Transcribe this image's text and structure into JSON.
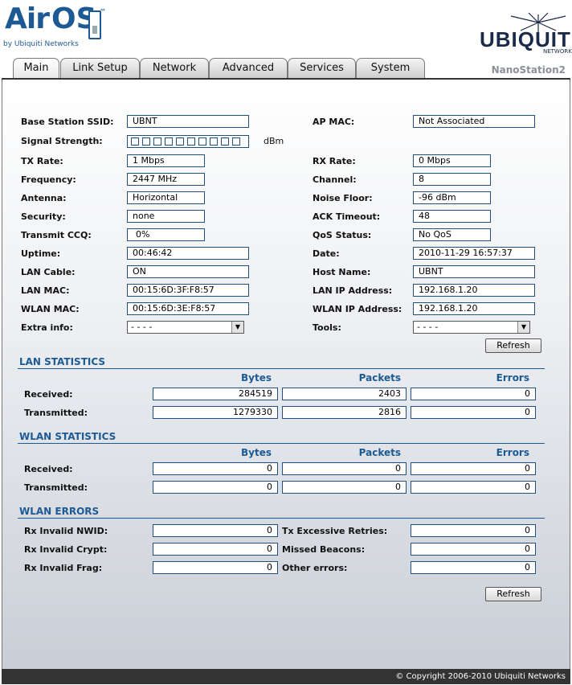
{
  "brand": {
    "logo_air": "Air",
    "logo_os": "OS",
    "logo_tm": "™",
    "logo_by": "by Ubiquiti Networks",
    "company": "UBIQUITI",
    "company_sub": "NETWORKS"
  },
  "tabs": [
    {
      "label": "Main",
      "active": true
    },
    {
      "label": "Link Setup"
    },
    {
      "label": "Network"
    },
    {
      "label": "Advanced"
    },
    {
      "label": "Services"
    },
    {
      "label": "System"
    }
  ],
  "device_name": "NanoStation2",
  "status": {
    "left": [
      {
        "label": "Base Station SSID:",
        "value": "UBNT"
      },
      {
        "label": "Signal Strength:",
        "unit": "dBm",
        "bars_filled": 0,
        "bars_total": 10
      },
      {
        "label": "TX Rate:",
        "value": "1 Mbps"
      },
      {
        "label": "Frequency:",
        "value": "2447 MHz"
      },
      {
        "label": "Antenna:",
        "value": "Horizontal"
      },
      {
        "label": "Security:",
        "value": "none"
      },
      {
        "label": "Transmit CCQ:",
        "value": "0%"
      },
      {
        "label": "Uptime:",
        "value": "00:46:42"
      },
      {
        "label": "LAN Cable:",
        "value": "ON"
      },
      {
        "label": "LAN MAC:",
        "value": "00:15:6D:3F:F8:57"
      },
      {
        "label": "WLAN MAC:",
        "value": "00:15:6D:3E:F8:57"
      },
      {
        "label": "Extra info:",
        "value": "- - - -"
      }
    ],
    "right": [
      {
        "label": "AP MAC:",
        "value": "Not Associated"
      },
      {
        "label": "RX Rate:",
        "value": "0 Mbps"
      },
      {
        "label": "Channel:",
        "value": "8"
      },
      {
        "label": "Noise Floor:",
        "value": "-96 dBm"
      },
      {
        "label": "ACK Timeout:",
        "value": "48"
      },
      {
        "label": "QoS Status:",
        "value": "No QoS"
      },
      {
        "label": "Date:",
        "value": "2010-11-29 16:57:37"
      },
      {
        "label": "Host Name:",
        "value": "UBNT"
      },
      {
        "label": "LAN IP Address:",
        "value": "192.168.1.20"
      },
      {
        "label": "WLAN IP Address:",
        "value": "192.168.1.20"
      },
      {
        "label": "Tools:",
        "value": "- - - -"
      }
    ]
  },
  "refresh_label": "Refresh",
  "columns": {
    "bytes": "Bytes",
    "packets": "Packets",
    "errors": "Errors"
  },
  "lan_stats": {
    "title": "LAN STATISTICS",
    "rows": [
      {
        "label": "Received:",
        "bytes": "284519",
        "packets": "2403",
        "errors": "0"
      },
      {
        "label": "Transmitted:",
        "bytes": "1279330",
        "packets": "2816",
        "errors": "0"
      }
    ]
  },
  "wlan_stats": {
    "title": "WLAN STATISTICS",
    "rows": [
      {
        "label": "Received:",
        "bytes": "0",
        "packets": "0",
        "errors": "0"
      },
      {
        "label": "Transmitted:",
        "bytes": "0",
        "packets": "0",
        "errors": "0"
      }
    ]
  },
  "wlan_errors": {
    "title": "WLAN ERRORS",
    "left": [
      {
        "label": "Rx Invalid NWID:",
        "value": "0"
      },
      {
        "label": "Rx Invalid Crypt:",
        "value": "0"
      },
      {
        "label": "Rx Invalid Frag:",
        "value": "0"
      }
    ],
    "right": [
      {
        "label": "Tx Excessive Retries:",
        "value": "0"
      },
      {
        "label": "Missed Beacons:",
        "value": "0"
      },
      {
        "label": "Other errors:",
        "value": "0"
      }
    ]
  },
  "footer": "© Copyright 2006-2010 Ubiquiti Networks",
  "colors": {
    "accent": "#1d5a94",
    "footer_bg": "#333333"
  }
}
